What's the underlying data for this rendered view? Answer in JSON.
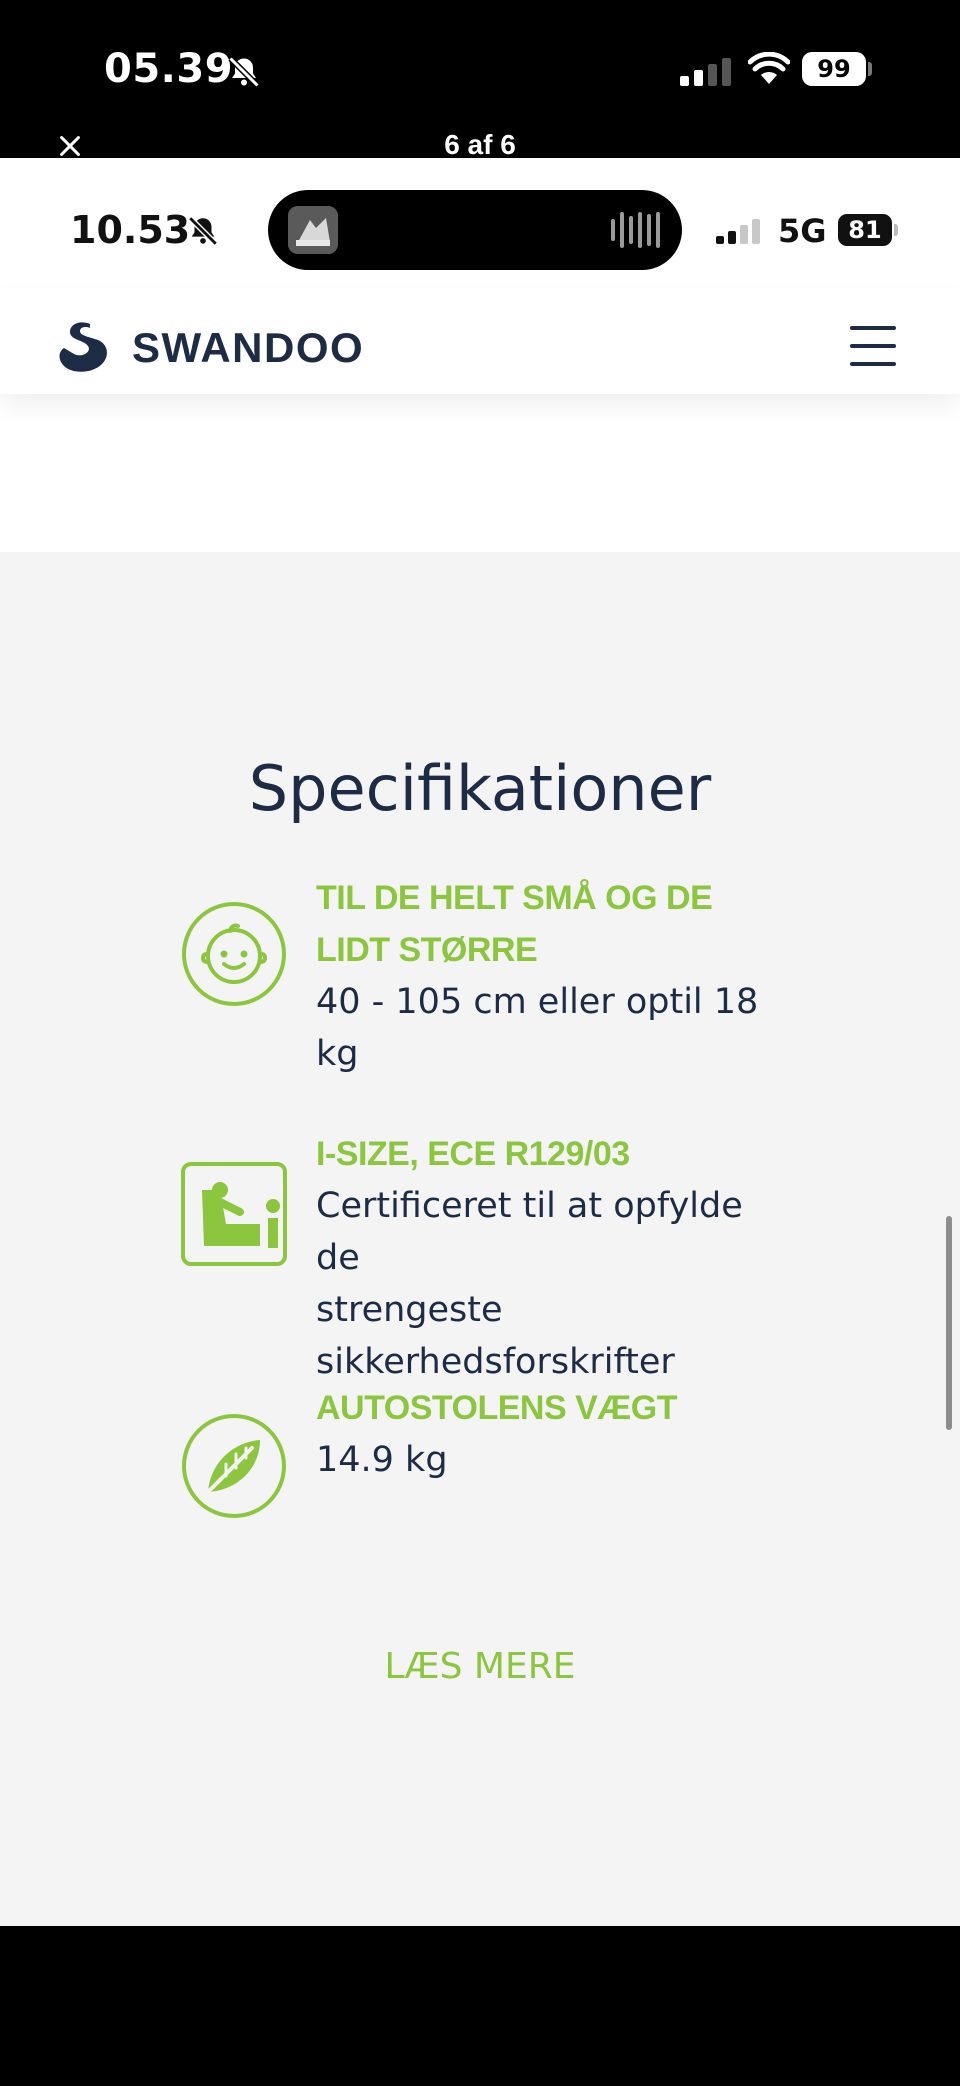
{
  "viewer": {
    "time": "05.39",
    "battery": "99",
    "title": "6 af 6"
  },
  "phone_status": {
    "time": "10.53",
    "network": "5G",
    "battery": "81"
  },
  "site": {
    "logo_text": "SWANDOO"
  },
  "specs": {
    "title": "Specifikationer",
    "items": [
      {
        "icon": "baby-face-icon",
        "label_lines": [
          "TIL DE HELT SMÅ OG DE",
          "LIDT STØRRE"
        ],
        "value_lines": [
          "40 - 105 cm eller optil 18",
          "kg"
        ]
      },
      {
        "icon": "car-seat-certificate-icon",
        "label_lines": [
          "I-SIZE, ECE R129/03"
        ],
        "value_lines": [
          "Certificeret til at opfylde de",
          "strengeste",
          "sikkerhedsforskrifter"
        ]
      },
      {
        "icon": "feather-weight-icon",
        "label_lines": [
          "AUTOSTOLENS VÆGT"
        ],
        "value_lines": [
          "14.9 kg"
        ]
      }
    ],
    "read_more": "LÆS MERE"
  },
  "colors": {
    "accent_green": "#8cc63f",
    "navy": "#1d2b45",
    "section_bg": "#f4f4f4"
  }
}
